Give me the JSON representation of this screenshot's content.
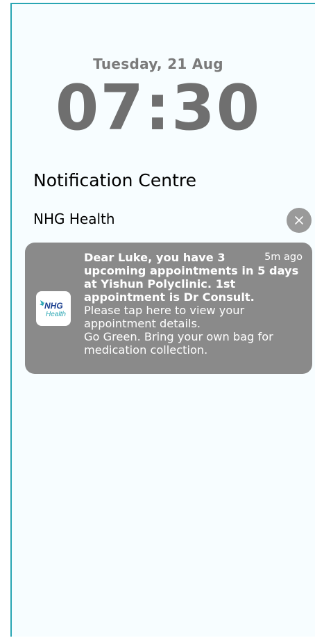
{
  "lockscreen": {
    "date": "Tuesday, 21 Aug",
    "time": "07:30"
  },
  "notification_centre": {
    "title": "Notification Centre",
    "group_app_name": "NHG Health",
    "close_icon": "close-icon"
  },
  "notification": {
    "time_ago": "5m ago",
    "line1": "Dear Luke, you have 3",
    "line2": "upcoming appointments in 5 days",
    "line3": "at Yishun Polyclinic. 1st",
    "line4": "appointment is Dr Consult.",
    "line5": "Please tap here to view your",
    "line6": "appointment details.",
    "line7": "Go Green. Bring your own bag for",
    "line8": "medication collection.",
    "app_icon": {
      "brand_top": "NHG",
      "brand_bottom": "Health",
      "brand_color": "#1b3f8f",
      "accent_color": "#2aa6b3"
    }
  },
  "colors": {
    "background": "#f7fdff",
    "card": "#8a8a8a",
    "frame_border": "#2aa6b3"
  }
}
